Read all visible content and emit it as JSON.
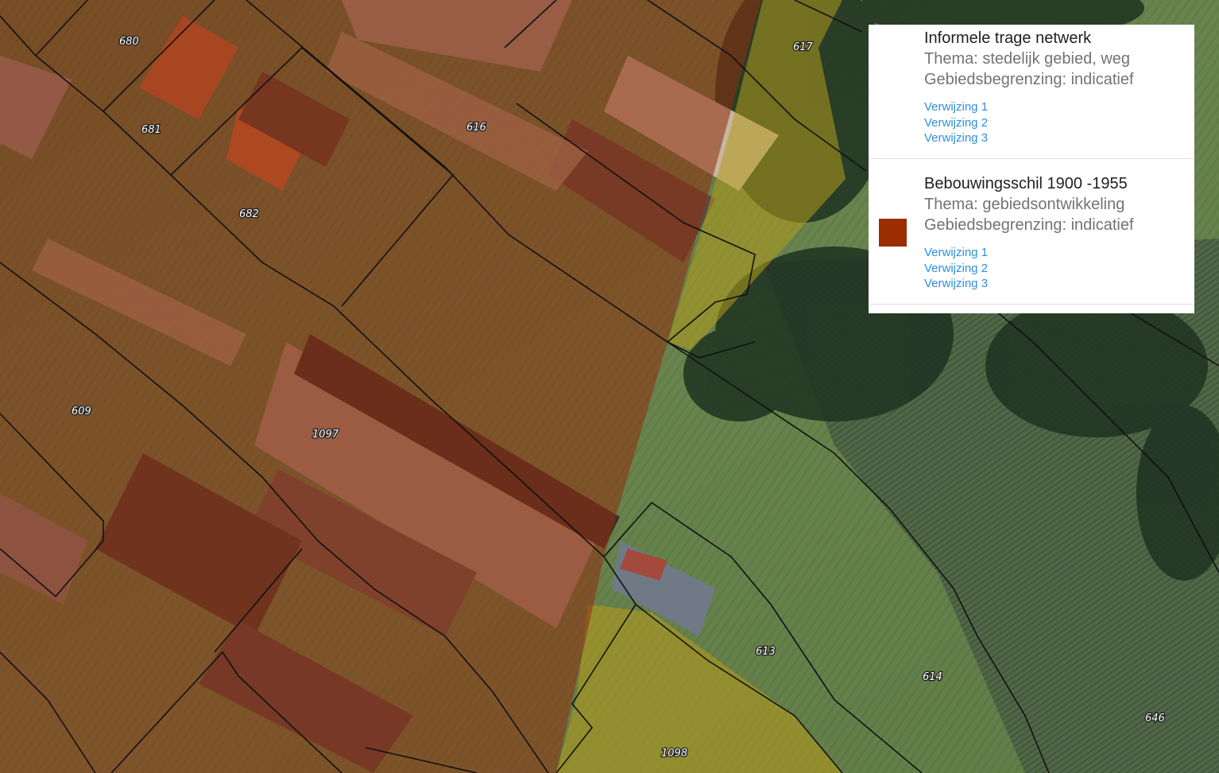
{
  "map": {
    "parcel_labels": [
      "680",
      "681",
      "682",
      "616",
      "617",
      "609",
      "1097",
      "613",
      "614",
      "646",
      "1098"
    ],
    "colors": {
      "bebouwingsschil_overlay": "#8f2d0e",
      "trage_netwerk_overlay": "#b39a1e",
      "parcel_border": "#111111",
      "field_green": "#5f7a48",
      "field_dark": "#3a4d34"
    }
  },
  "legend": {
    "entries": [
      {
        "title": "Informele trage netwerk",
        "thema": "Thema: stedelijk gebied, weg",
        "begrenzing": "Gebiedsbegrenzing: indicatief",
        "swatch_color": "",
        "links": [
          "Verwijzing 1",
          "Verwijzing 2",
          "Verwijzing 3"
        ]
      },
      {
        "title": "Bebouwingsschil 1900 -1955",
        "thema": "Thema: gebiedsontwikkeling",
        "begrenzing": "Gebiedsbegrenzing: indicatief",
        "swatch_color": "#9b2d00",
        "links": [
          "Verwijzing 1",
          "Verwijzing 2",
          "Verwijzing 3"
        ]
      }
    ]
  }
}
